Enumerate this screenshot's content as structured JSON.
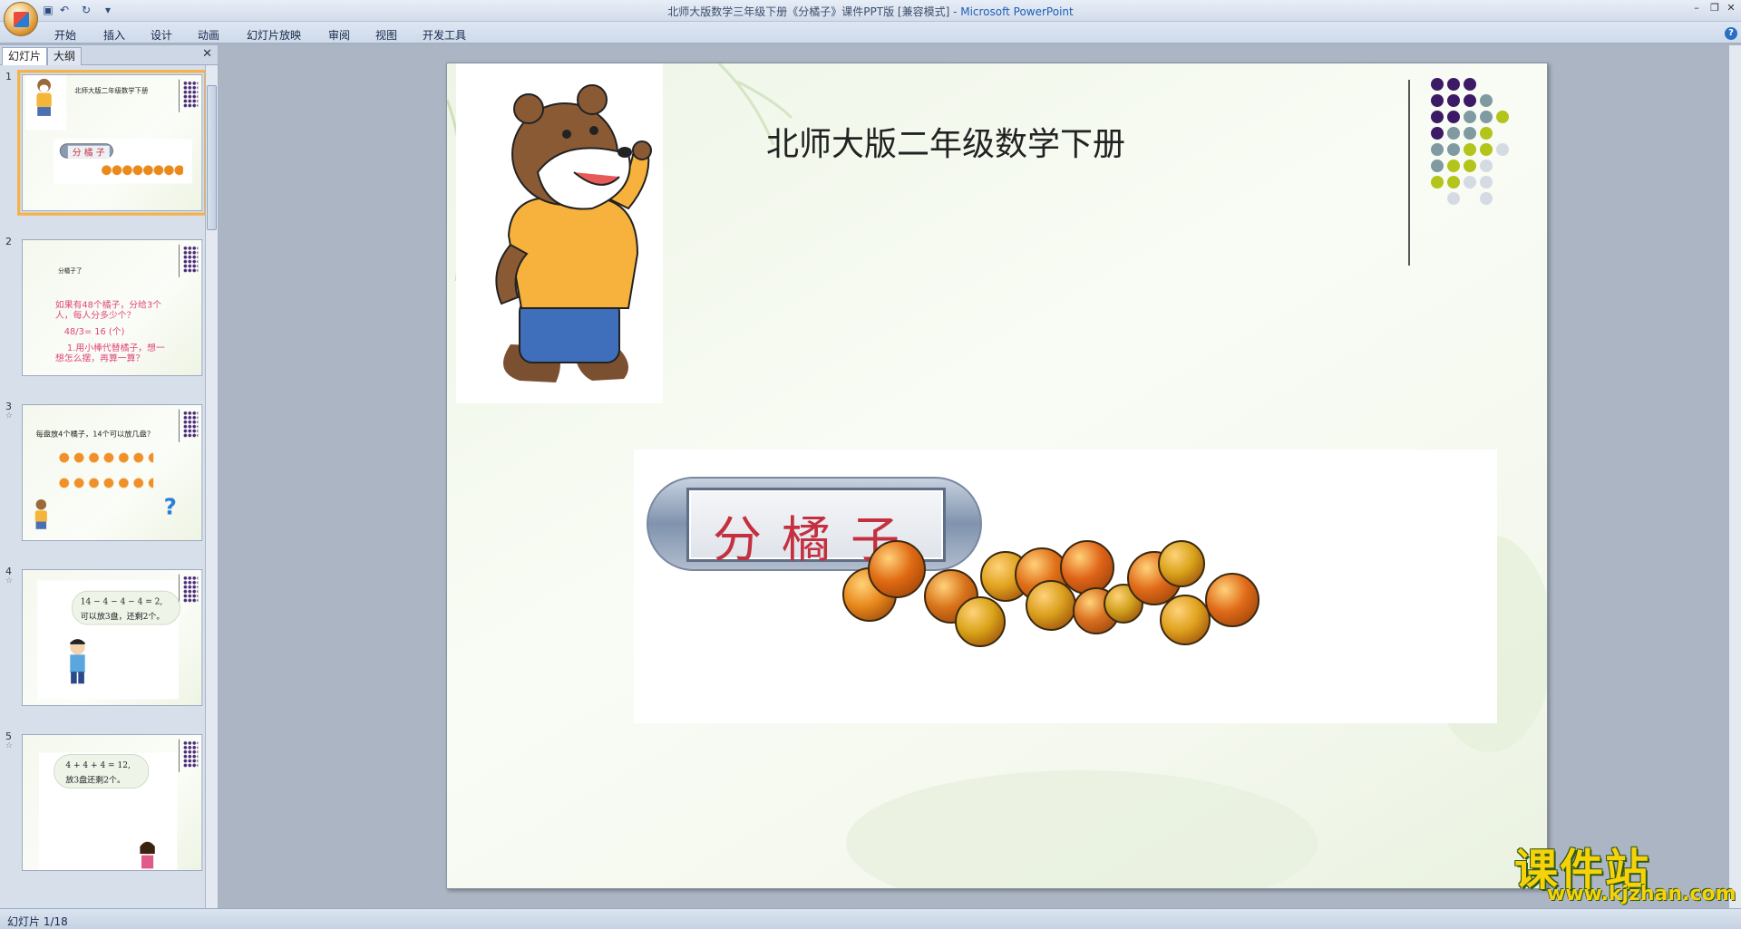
{
  "window": {
    "title": "北师大版数学三年级下册《分橘子》课件PPT版 [兼容模式] - ",
    "app_name": "Microsoft PowerPoint",
    "min": "–",
    "restore": "❐",
    "close": "✕"
  },
  "quick_access": {
    "save": "💾",
    "undo": "↶",
    "redo": "↻",
    "more": "▾"
  },
  "menu": [
    "开始",
    "插入",
    "设计",
    "动画",
    "幻灯片放映",
    "审阅",
    "视图",
    "开发工具"
  ],
  "help": "?",
  "panel": {
    "tabs": [
      "幻灯片",
      "大纲"
    ],
    "close": "✕",
    "slides": [
      {
        "num": "1",
        "title": "北师大版二年级数学下册",
        "label": "分 橘 子"
      },
      {
        "num": "2",
        "star": "☆",
        "heading": "分橘子了",
        "q1": "如果有48个橘子，分给3个",
        "q2": "人，每人分多少个？",
        "calc": "48/3= 16 (个)",
        "t1": "1.用小棒代替橘子，想一",
        "t2": "想怎么摆，再算一算？"
      },
      {
        "num": "3",
        "star": "☆",
        "q": "每盘放4个橘子，14个可以放几盘？",
        "mark": "?"
      },
      {
        "num": "4",
        "star": "☆",
        "b1": "14 − 4 − 4 − 4 = 2,",
        "b2": "可以放3盘，还剩2个。"
      },
      {
        "num": "5",
        "star": "☆",
        "b1": "4 + 4 + 4 = 12,",
        "b2": "放3盘还剩2个。"
      }
    ]
  },
  "slide": {
    "title": "北师大版二年级数学下册",
    "plate_text": "分橘子"
  },
  "status": {
    "text": "幻灯片 1/18"
  },
  "watermark": {
    "cn": "课件站",
    "url": "www.kjzhan.com"
  },
  "colors": {
    "purple": "#3c1a66",
    "grey": "#7f9aa0",
    "lime": "#b3c41a",
    "light": "#d5dbe3"
  }
}
